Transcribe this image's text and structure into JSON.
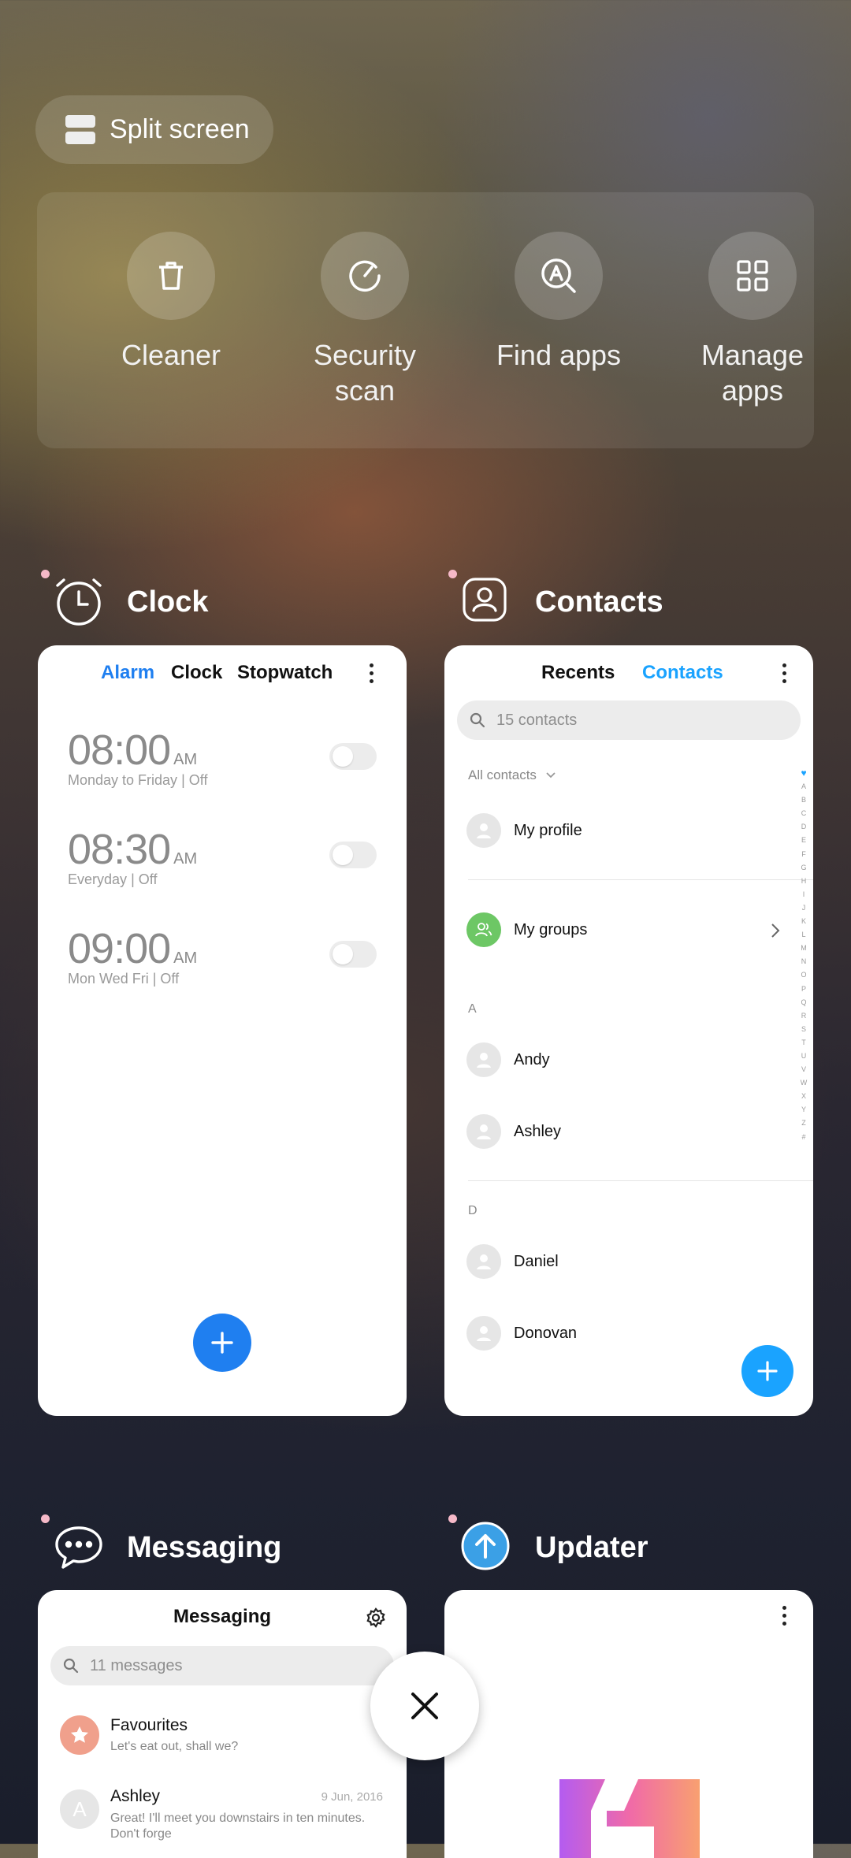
{
  "split_screen": {
    "label": "Split screen"
  },
  "quick_actions": [
    {
      "label": "Cleaner",
      "icon": "trash-icon"
    },
    {
      "label": "Security scan",
      "icon": "security-scan-icon"
    },
    {
      "label": "Find apps",
      "icon": "find-apps-icon"
    },
    {
      "label": "Manage apps",
      "icon": "manage-apps-icon"
    }
  ],
  "apps": {
    "clock": {
      "title": "Clock",
      "tabs": [
        "Alarm",
        "Clock",
        "Stopwatch"
      ],
      "active_tab": "Alarm",
      "alarms": [
        {
          "time": "08:00",
          "ampm": "AM",
          "repeat": "Monday to Friday",
          "state": "Off"
        },
        {
          "time": "08:30",
          "ampm": "AM",
          "repeat": "Everyday",
          "state": "Off"
        },
        {
          "time": "09:00",
          "ampm": "AM",
          "repeat": "Mon Wed Fri",
          "state": "Off"
        }
      ],
      "sep": "|"
    },
    "contacts": {
      "title": "Contacts",
      "tabs": [
        "Recents",
        "Contacts"
      ],
      "active_tab": "Contacts",
      "search_placeholder": "15 contacts",
      "filter": "All contacts",
      "my_profile": "My profile",
      "my_groups": "My groups",
      "section_a": "A",
      "section_d": "D",
      "contacts_a": [
        "Andy",
        "Ashley"
      ],
      "contacts_d": [
        "Daniel",
        "Donovan"
      ],
      "alphabet": [
        "A",
        "B",
        "C",
        "D",
        "E",
        "F",
        "G",
        "H",
        "I",
        "J",
        "K",
        "L",
        "M",
        "N",
        "O",
        "P",
        "Q",
        "R",
        "S",
        "T",
        "U",
        "V",
        "W",
        "X",
        "Y",
        "Z",
        "#"
      ]
    },
    "messaging": {
      "title": "Messaging",
      "header": "Messaging",
      "search_placeholder": "11 messages",
      "threads": [
        {
          "name": "Favourites",
          "preview": "Let's eat out, shall we?",
          "date": ""
        },
        {
          "name": "Ashley",
          "initial": "A",
          "preview": "Great! I'll meet you downstairs in ten minutes. Don't forge",
          "date": "9 Jun, 2016"
        }
      ]
    },
    "updater": {
      "title": "Updater"
    }
  },
  "colors": {
    "accent_blue": "#1f7ff0",
    "contacts_blue": "#1aa3ff",
    "groups_green": "#6dc765"
  }
}
